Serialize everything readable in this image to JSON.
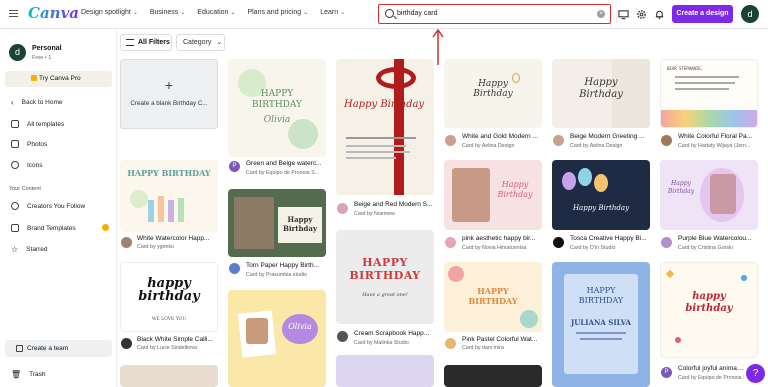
{
  "header": {
    "logo": "Canva",
    "nav": [
      "Design spotlight",
      "Business",
      "Education",
      "Plans and pricing",
      "Learn"
    ],
    "search_value": "birthday card",
    "create_label": "Create a design",
    "avatar_letter": "d"
  },
  "sidebar": {
    "account_letter": "d",
    "account_name": "Personal",
    "account_sub": "Free • 1",
    "try_label": "Try Canva Pro",
    "items": [
      "Back to Home",
      "All templates",
      "Photos",
      "Icons"
    ],
    "section": "Your Content",
    "content_items": [
      "Creators You Follow",
      "Brand Templates",
      "Starred"
    ],
    "team_label": "Create a team",
    "trash_label": "Trash"
  },
  "filters": {
    "all_label": "All Filters",
    "category_label": "Category"
  },
  "blank_card": {
    "label": "Create a blank Birthday C..."
  },
  "templates": [
    {
      "title": "White Watercolor Happ...",
      "by": "Card by ygenko"
    },
    {
      "title": "Black White Simple Calli...",
      "by": "Card by Lucie Sindelkova"
    },
    {
      "title": "Green and Beige waterc...",
      "by": "Card by Equipo de Pronoia S..."
    },
    {
      "title": "Torn Paper Happy Birth...",
      "by": "Card by Prasumbia studio"
    },
    {
      "title": "Beige and Red Modern S...",
      "by": "Card by Noemew"
    },
    {
      "title": "Cream Scrapbook Happ...",
      "by": "Card by Malinka Studio"
    },
    {
      "title": "White and Gold Modern ...",
      "by": "Card by Aelina Design"
    },
    {
      "title": "pink aesthetic happy bir...",
      "by": "Card by Novia Himatunnisa"
    },
    {
      "title": "Pink Pastel Colorful Wat...",
      "by": "Card by dani mira"
    },
    {
      "title": "Beige Modern Greeting ...",
      "by": "Card by Aelina Design"
    },
    {
      "title": "Tosca Creative Happy Bi...",
      "by": "Card by D'iri Studio"
    },
    {
      "title": "White Colorful Floral Pa...",
      "by": "Card by Hartaty Wijaya (Jern..."
    },
    {
      "title": "Purple Blue Watercolou...",
      "by": "Card by Cristina Gorski"
    },
    {
      "title": "Colorful joyful animat...",
      "by": "Card by Equipo de Pronoia S..."
    }
  ],
  "thumb_text": {
    "green_title": "HAPPY BIRTHDAY",
    "green_name": "Olivia",
    "beige_red": "Happy Birthday",
    "white_gold": "Happy Birthday",
    "beige_modern": "Happy Birthday",
    "floral_note": "DEAR STEPHANIE,",
    "watercolor": "HAPPY BIRTHDAY",
    "calli": "happy birthday",
    "calli_sub": "WE LOVE YOU",
    "torn": "Happy Birthday",
    "scrap": "HAPPY BIRTHDAY",
    "scrap_sub": "Have a great one!",
    "pink_aesthetic": "Happy Birthday",
    "tosca": "Happy Birthday",
    "purple_blue": "Happy Birthday",
    "pastel": "HAPPY BIRTHDAY",
    "blue_card": "HAPPY BIRTHDAY",
    "blue_name": "JULIANA SILVA",
    "joyful": "happy birthday",
    "olivia_purple": "Olivia"
  }
}
